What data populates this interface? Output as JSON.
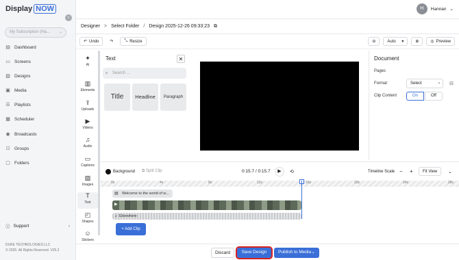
{
  "brand": {
    "name": "Display",
    "now": "NOW"
  },
  "subscription": {
    "placeholder": "My Subscription (Ha..."
  },
  "nav": [
    {
      "label": "Dashboard",
      "icon": "dashboard-icon"
    },
    {
      "label": "Screens",
      "icon": "screen-icon"
    },
    {
      "label": "Designs",
      "icon": "designs-icon"
    },
    {
      "label": "Media",
      "icon": "media-icon"
    },
    {
      "label": "Playlists",
      "icon": "playlist-icon"
    },
    {
      "label": "Scheduler",
      "icon": "calendar-icon"
    },
    {
      "label": "Broadcasts",
      "icon": "broadcast-icon"
    },
    {
      "label": "Groups",
      "icon": "groups-icon"
    },
    {
      "label": "Folders",
      "icon": "folder-icon"
    }
  ],
  "support": "Support",
  "company": {
    "line1": "DUKE TECHNOLOGIES LLC",
    "line2": "© 2025. All Rights Reserved. V25.2"
  },
  "user": {
    "initial": "H",
    "name": "Hannan"
  },
  "breadcrumb": {
    "root": "Designer",
    "folder": "Select Folder",
    "design": "Design 2025-12-26 09:33:23"
  },
  "toolbar": {
    "undo": "Undo",
    "resize": "Resize",
    "zoom": "Auto",
    "preview": "Preview"
  },
  "tools": [
    "AI",
    "Elements",
    "Uploads",
    "Videos",
    "Audio",
    "Captions",
    "Images",
    "Text",
    "Shapes",
    "Stickers"
  ],
  "textPanel": {
    "title": "Text",
    "search_placeholder": "Search ...",
    "title_card": "Title",
    "heading_card": "Headline",
    "paragraph_card": "Paragraph"
  },
  "document": {
    "title": "Document",
    "pages": "Pages",
    "format_label": "Format",
    "format_value": "Select",
    "clip_label": "Clip Content",
    "on": "On",
    "off": "Off"
  },
  "timeline": {
    "background": "Background",
    "split": "Split Clip",
    "time": "0:15.7 / 0:15.7",
    "scale_label": "Timeline Scale",
    "fit": "Fit View",
    "ticks": [
      "0s",
      "4s",
      "8s",
      "12s",
      "16s",
      "20s",
      "24s",
      "28s"
    ],
    "text_clip": "Welcome to the world of w...",
    "audio_clip": "Elsewhere",
    "add_clip": "+ Add Clip"
  },
  "footer": {
    "discard": "Discard",
    "save": "Save Design",
    "publish": "Publish to Media"
  },
  "colors": {
    "accent": "#3a6fd8",
    "save_outline": "#d92020",
    "canvas": "#000000"
  }
}
